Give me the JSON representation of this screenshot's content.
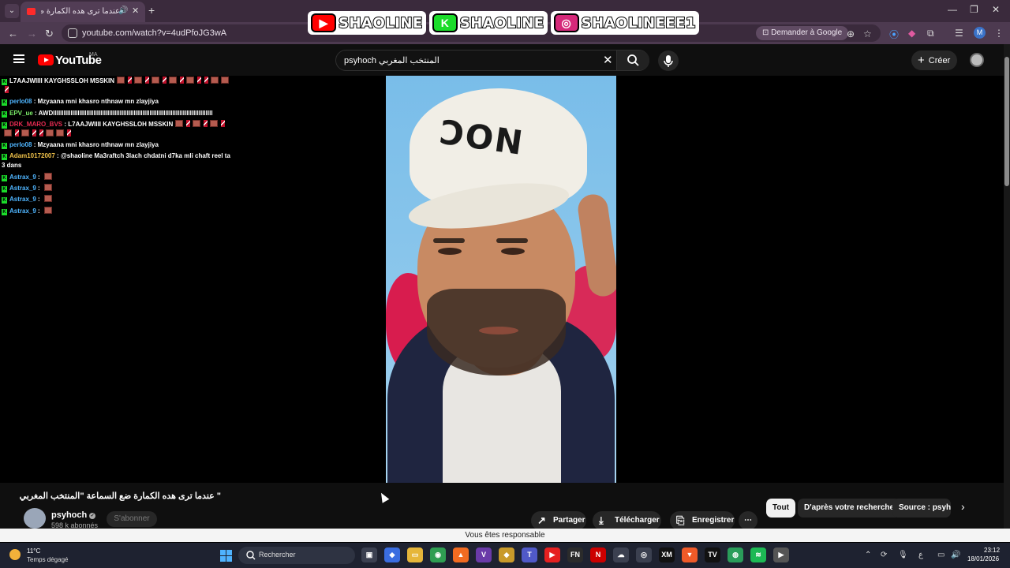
{
  "browser": {
    "tab_title": "عندما ترى هده الكمارة ضع ال...",
    "url": "youtube.com/watch?v=4udPfoJG3wA",
    "ask_google": "Demander à Google",
    "profile_initial": "M"
  },
  "banner": [
    {
      "icon_name": "youtube-icon",
      "text": "SHAOLINE",
      "color": "#ff0000",
      "glyph": "▶"
    },
    {
      "icon_name": "kick-icon",
      "text": "SHAOLINE",
      "color": "#1bdc2a",
      "glyph": "K"
    },
    {
      "icon_name": "instagram-icon",
      "text": "SHAOLINEEE1",
      "color": "#d6297a",
      "glyph": "◎"
    }
  ],
  "youtube": {
    "logo": "YouTube",
    "country": "MA",
    "search_value": "psyhoch المنتخب المغربي",
    "create_label": "Créer"
  },
  "chat": [
    {
      "user": "",
      "user_color": "red",
      "text": "L7AAJWIIII KAYGHSSLOH MSSKIN",
      "emotes": "pattern"
    },
    {
      "user": "perlo08",
      "user_color": "blue",
      "text": "Mzyaana mni khasro nthnaw mn zlayjiya",
      "emotes": ""
    },
    {
      "user": "EPV_ue",
      "user_color": "green",
      "text": "AWDIIIIIIIIIIIIIIIIIIIIIIIIIIIIIIIIIIIIIIIIIIIIIIIIIIIIIIIIIIIIIIIIIIIIIIIIIIIIIIIIIIIIIIIIIII",
      "emotes": ""
    },
    {
      "user": "DRK_MARO_BVS",
      "user_color": "red",
      "text": "L7AAJWIIII KAYGHSSLOH MSSKIN",
      "emotes": "pattern"
    },
    {
      "user": "perlo08",
      "user_color": "blue",
      "text": "Mzyaana mni khasro nthnaw mn zlayjiya",
      "emotes": ""
    },
    {
      "user": "Adam10172007",
      "user_color": "yellow",
      "text": "@shaoline Ma3raftch 3lach chdatni d7ka mli chaft reel ta3 dans",
      "emotes": ""
    },
    {
      "user": "Astrax_9",
      "user_color": "blue",
      "text": "",
      "emotes": "single"
    },
    {
      "user": "Astrax_9",
      "user_color": "blue",
      "text": "",
      "emotes": "single"
    },
    {
      "user": "Astrax_9",
      "user_color": "blue",
      "text": "",
      "emotes": "single"
    },
    {
      "user": "Astrax_9",
      "user_color": "blue",
      "text": "",
      "emotes": "single"
    }
  ],
  "video": {
    "cap_text": "NOC",
    "title": "\" عندما ترى هده الكمارة ضع السماعة \"المنتخب المغربي",
    "channel": "psyhoch",
    "subscribers": "598 k abonnés",
    "subscribe_label": "S'abonner",
    "actions": [
      {
        "label": "Partager",
        "icon": "share-icon",
        "glyph": "↗"
      },
      {
        "label": "Télécharger",
        "icon": "download-icon",
        "glyph": "⤓"
      },
      {
        "label": "Enregistrer",
        "icon": "bookmark-icon",
        "glyph": "⎘"
      }
    ],
    "chips": [
      {
        "label": "Tout",
        "active": true
      },
      {
        "label": "D'après votre recherche",
        "active": false
      },
      {
        "label": "Source : psyhoch",
        "active": false
      }
    ]
  },
  "notice": "Vous êtes responsable",
  "taskbar": {
    "temperature": "11°C",
    "weather": "Temps dégagé",
    "search_placeholder": "Rechercher",
    "time": "23:12",
    "date": "18/01/2026",
    "apps": [
      {
        "name": "task-view-icon",
        "glyph": "▣",
        "color": "#3b4050"
      },
      {
        "name": "copilot-icon",
        "glyph": "◆",
        "color": "#3a6de0"
      },
      {
        "name": "file-explorer-icon",
        "glyph": "▭",
        "color": "#e6b63a"
      },
      {
        "name": "chrome-icon",
        "glyph": "◉",
        "color": "#2f9e52"
      },
      {
        "name": "brave-icon",
        "glyph": "▲",
        "color": "#f26b21"
      },
      {
        "name": "visual-studio-icon",
        "glyph": "V",
        "color": "#6a3aa8"
      },
      {
        "name": "shield-icon",
        "glyph": "◆",
        "color": "#c99a2a"
      },
      {
        "name": "teams-icon",
        "glyph": "T",
        "color": "#5059c9"
      },
      {
        "name": "youtube-app-icon",
        "glyph": "▶",
        "color": "#e62020"
      },
      {
        "name": "fn-app-icon",
        "glyph": "FN",
        "color": "#2b2b2b"
      },
      {
        "name": "netflix-icon",
        "glyph": "N",
        "color": "#c00"
      },
      {
        "name": "cloud-icon",
        "glyph": "☁",
        "color": "#3b4050"
      },
      {
        "name": "chat-app-icon",
        "glyph": "◎",
        "color": "#3b4050"
      },
      {
        "name": "xm-icon",
        "glyph": "XM",
        "color": "#111"
      },
      {
        "name": "brave-browser-icon",
        "glyph": "▼",
        "color": "#f05a28"
      },
      {
        "name": "tradingview-icon",
        "glyph": "TV",
        "color": "#111"
      },
      {
        "name": "android-icon",
        "glyph": "◍",
        "color": "#2a9d5a"
      },
      {
        "name": "spotify-icon",
        "glyph": "≋",
        "color": "#1db954"
      },
      {
        "name": "media-player-icon",
        "glyph": "▶",
        "color": "#555"
      }
    ]
  }
}
